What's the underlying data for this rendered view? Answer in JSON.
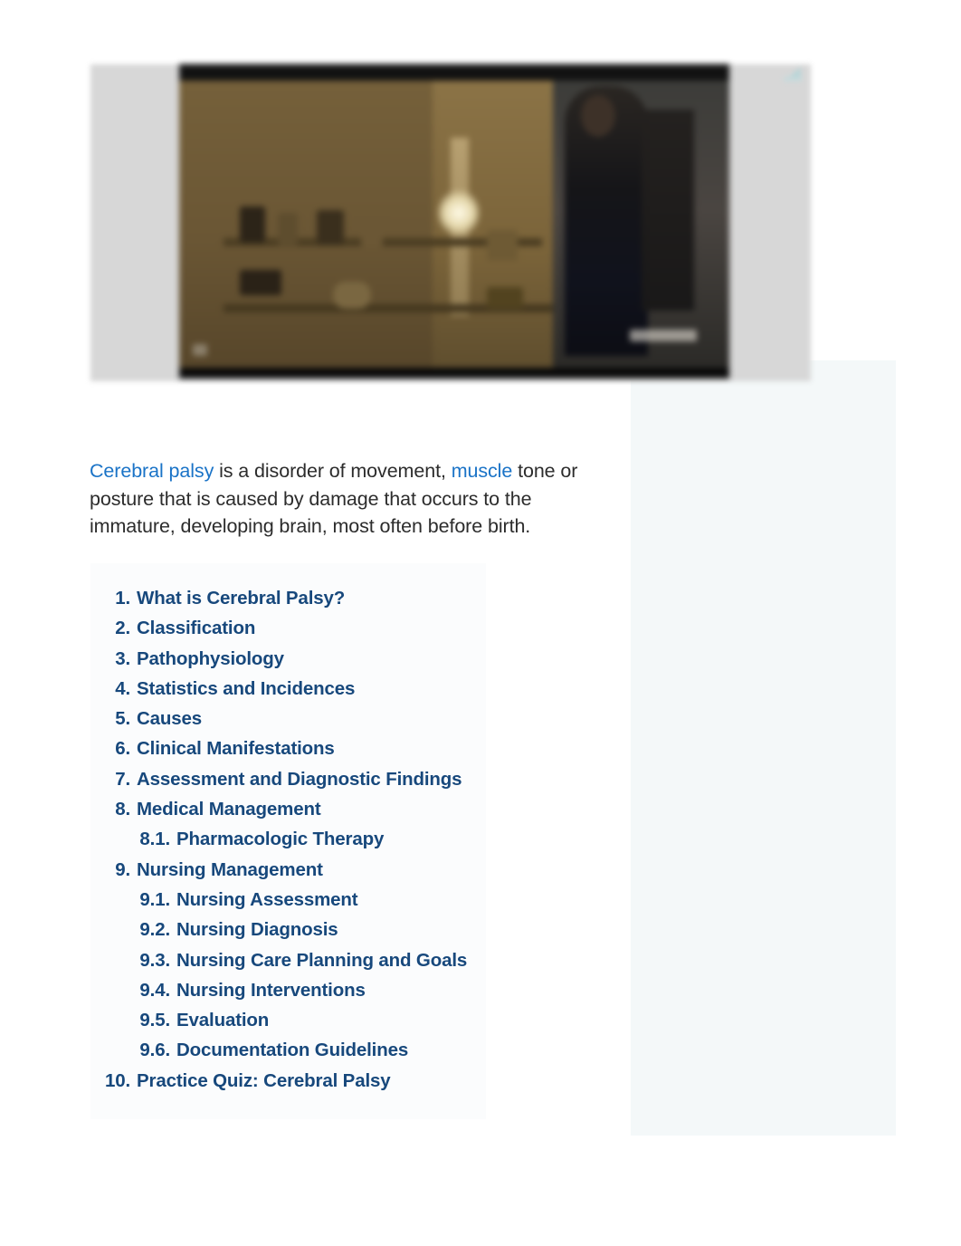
{
  "advertisement": {
    "label": "video-advertisement",
    "adchoices_icon": "adchoices-icon",
    "media_type": "video"
  },
  "article": {
    "intro": {
      "link1_text": "Cerebral palsy",
      "segment1": " is a disorder of movement, ",
      "link2_text": "muscle",
      "segment2": " tone or posture that is caused by damage that occurs to the immature, developing brain, most often before birth."
    }
  },
  "toc": {
    "items": [
      {
        "number": "1.",
        "label": "What is Cerebral Palsy?",
        "level": 1
      },
      {
        "number": "2.",
        "label": "Classification",
        "level": 1
      },
      {
        "number": "3.",
        "label": "Pathophysiology",
        "level": 1
      },
      {
        "number": "4.",
        "label": "Statistics and Incidences",
        "level": 1
      },
      {
        "number": "5.",
        "label": "Causes",
        "level": 1
      },
      {
        "number": "6.",
        "label": "Clinical Manifestations",
        "level": 1
      },
      {
        "number": "7.",
        "label": "Assessment and Diagnostic Findings",
        "level": 1
      },
      {
        "number": "8.",
        "label": "Medical Management",
        "level": 1
      },
      {
        "number": "8.1.",
        "label": "Pharmacologic Therapy",
        "level": 2
      },
      {
        "number": "9.",
        "label": "Nursing Management",
        "level": 1
      },
      {
        "number": "9.1.",
        "label": "Nursing Assessment",
        "level": 2
      },
      {
        "number": "9.2.",
        "label": "Nursing Diagnosis",
        "level": 2
      },
      {
        "number": "9.3.",
        "label": "Nursing Care Planning and Goals",
        "level": 2
      },
      {
        "number": "9.4.",
        "label": "Nursing Interventions",
        "level": 2
      },
      {
        "number": "9.5.",
        "label": "Evaluation",
        "level": 2
      },
      {
        "number": "9.6.",
        "label": "Documentation Guidelines",
        "level": 2
      },
      {
        "number": "10.",
        "label": "Practice Quiz: Cerebral Palsy",
        "level": 1
      }
    ]
  },
  "colors": {
    "link_blue": "#1a73c7",
    "toc_link_navy": "#17487c",
    "body_text": "#2c2c2c",
    "ad_backdrop": "#d7d7d7",
    "side_panel": "#f4f8f9",
    "toc_background": "#fbfcfd"
  }
}
